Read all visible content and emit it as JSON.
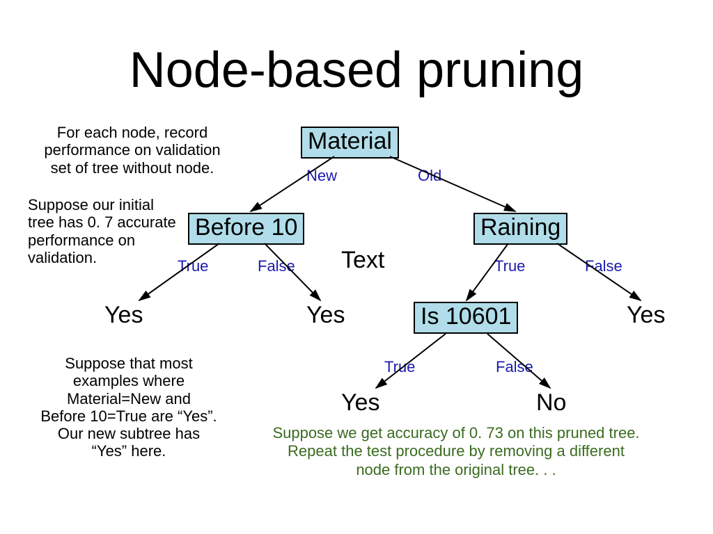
{
  "title": "Node-based pruning",
  "annot1": "For each node, record\nperformance on validation\nset of tree without node.",
  "annot2": "Suppose our initial\ntree has 0. 7 accurate\nperformance on\nvalidation.",
  "annot3": "Suppose that most\nexamples where\nMaterial=New and\nBefore 10=True are “Yes”.\nOur new subtree has\n“Yes” here.",
  "nodes": {
    "material": "Material",
    "before10": "Before 10",
    "raining": "Raining",
    "is10601": "Is 10601"
  },
  "edges": {
    "new": "New",
    "old": "Old",
    "true1": "True",
    "false1": "False",
    "true2": "True",
    "false2": "False",
    "true3": "True",
    "false3": "False"
  },
  "text_label": "Text",
  "leaves": {
    "yes1": "Yes",
    "yes2": "Yes",
    "yes3": "Yes",
    "yes4": "Yes",
    "no": "No"
  },
  "bottom_note": "Suppose we get accuracy of 0. 73 on this pruned tree.\nRepeat the test procedure by removing a different\nnode from the original tree. . ."
}
